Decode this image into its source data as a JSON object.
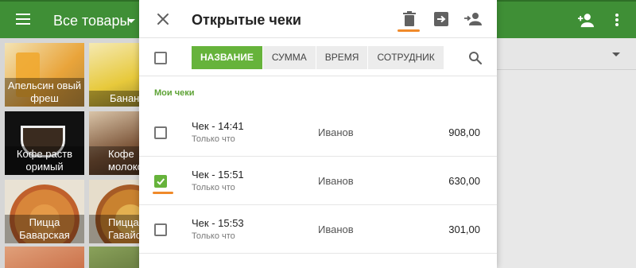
{
  "app": {
    "title": "Все товары",
    "tiles": [
      {
        "label": "Апельсин овый фреш",
        "color": "#d9a43a"
      },
      {
        "label": "Банан",
        "color": "#e7c93b"
      },
      {
        "label": "Кофе раств оримый",
        "color": "#3a2b1f"
      },
      {
        "label": "Кофе молоко",
        "color": "#7b5438"
      },
      {
        "label": "Пицца Баварская",
        "color": "#d8863a"
      },
      {
        "label": "Пицца Гавайская",
        "color": "#c9822f"
      }
    ]
  },
  "dialog": {
    "title": "Открытые чеки",
    "header_icons": [
      "delete-icon",
      "transfer-icon",
      "assign-employee-icon"
    ],
    "sort_tabs": [
      {
        "label": "НАЗВАНИЕ",
        "active": true
      },
      {
        "label": "СУММА",
        "active": false
      },
      {
        "label": "ВРЕМЯ",
        "active": false
      },
      {
        "label": "СОТРУДНИК",
        "active": false
      }
    ],
    "section_label": "Мои чеки",
    "receipts": [
      {
        "name": "Чек - 14:41",
        "time": "Только что",
        "employee": "Иванов",
        "amount": "908,00",
        "checked": false
      },
      {
        "name": "Чек - 15:51",
        "time": "Только что",
        "employee": "Иванов",
        "amount": "630,00",
        "checked": true
      },
      {
        "name": "Чек - 15:53",
        "time": "Только что",
        "employee": "Иванов",
        "amount": "301,00",
        "checked": false
      }
    ]
  },
  "colors": {
    "app_bar": "#3f8f36",
    "accent_green": "#66b33b",
    "highlight_orange": "#f08a2a"
  }
}
